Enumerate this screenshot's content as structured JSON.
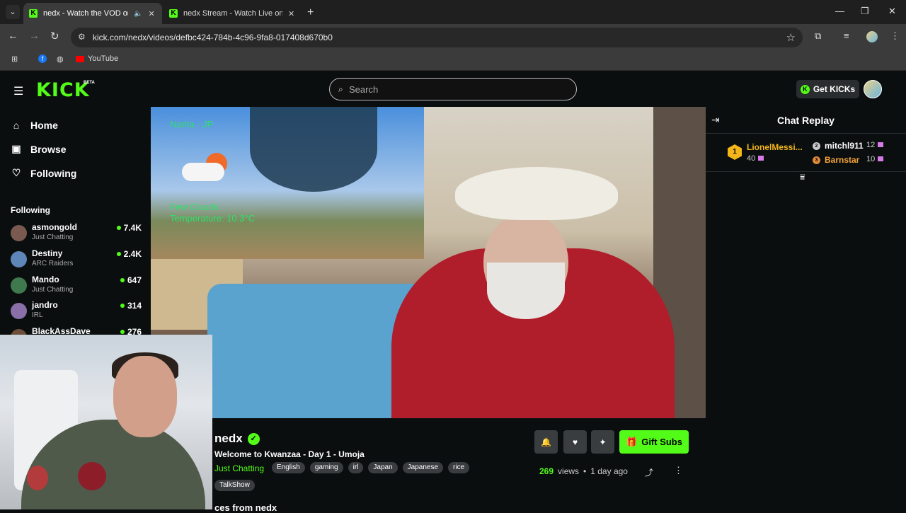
{
  "browser": {
    "tabs": [
      {
        "title": "nedx - Watch the VOD on Ki",
        "active": true
      },
      {
        "title": "nedx Stream - Watch Live on Ki",
        "active": false
      }
    ],
    "url": "kick.com/nedx/videos/defbc424-784b-4c96-9fa8-017408d670b0",
    "bookmarks": [
      {
        "label": "YouTube"
      }
    ]
  },
  "header": {
    "logo": "KICK",
    "beta": "BETA",
    "search_placeholder": "Search",
    "get_kicks": "Get KICKs"
  },
  "sidebar": {
    "nav": [
      {
        "label": "Home",
        "icon": "home-icon"
      },
      {
        "label": "Browse",
        "icon": "browse-icon"
      },
      {
        "label": "Following",
        "icon": "heart-icon"
      }
    ],
    "following_title": "Following",
    "following": [
      {
        "name": "asmongold",
        "category": "Just Chatting",
        "viewers": "7.4K",
        "color": "#7a5a50"
      },
      {
        "name": "Destiny",
        "category": "ARC Raiders",
        "viewers": "2.4K",
        "color": "#5f86b8"
      },
      {
        "name": "Mando",
        "category": "Just Chatting",
        "viewers": "647",
        "color": "#3f7a4f"
      },
      {
        "name": "jandro",
        "category": "IRL",
        "viewers": "314",
        "color": "#8a6fa8"
      },
      {
        "name": "BlackAssDave",
        "category": "",
        "viewers": "276",
        "color": "#6b4f3a"
      }
    ]
  },
  "video": {
    "overlay": {
      "location": "Narita - JP",
      "weather_line1": "Few Clouds",
      "weather_line2": "Temperature: 10.3°C"
    }
  },
  "channel": {
    "name": "nedx",
    "title": "Welcome to Kwanzaa - Day 1 - Umoja",
    "category": "Just Chatting",
    "tags": [
      "English",
      "gaming",
      "irl",
      "Japan",
      "Japanese",
      "rice"
    ],
    "tags_row2": [
      "TalkShow"
    ],
    "gift_subs": "Gift Subs",
    "views": "269",
    "views_label": "views",
    "dot": "•",
    "time_ago": "1 day ago",
    "below_hint": "ces from nedx"
  },
  "chat": {
    "title": "Chat Replay",
    "gifters": [
      {
        "rank": "1",
        "name": "LionelMessi...",
        "count": "40"
      },
      {
        "rank": "2",
        "name": "mitchl911",
        "count": "12"
      },
      {
        "rank": "3",
        "name": "Barnstar",
        "count": "10"
      }
    ]
  },
  "colors": {
    "accent": "#53fc18",
    "background": "#0b0e0f",
    "gold": "#f3b51a"
  }
}
